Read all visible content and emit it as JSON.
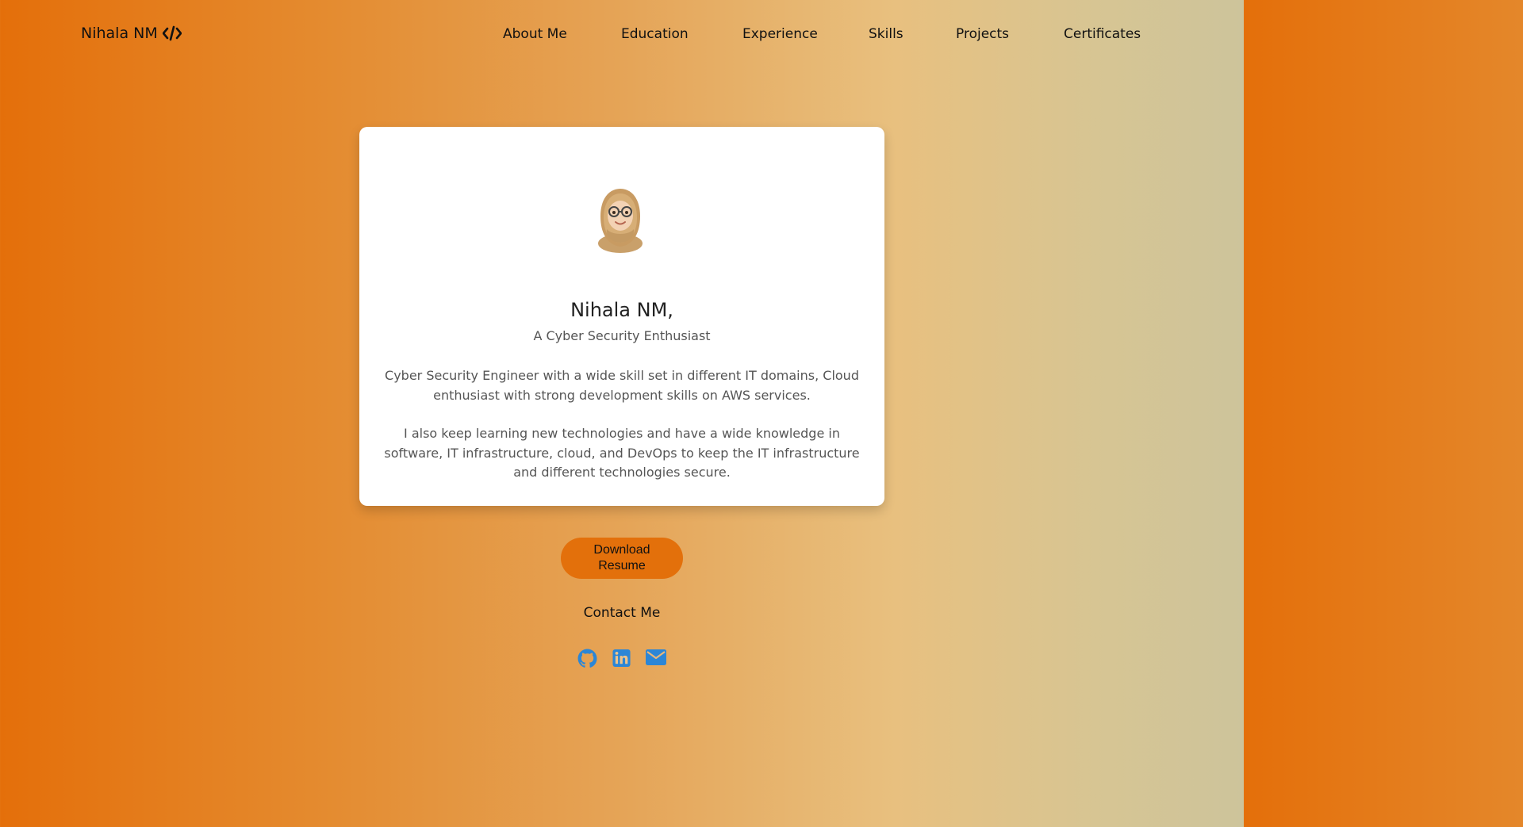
{
  "brand": {
    "name": "Nihala NM",
    "icon": "code-icon"
  },
  "nav": {
    "items": [
      {
        "label": "About Me"
      },
      {
        "label": "Education"
      },
      {
        "label": "Experience"
      },
      {
        "label": "Skills"
      },
      {
        "label": "Projects"
      },
      {
        "label": "Certificates"
      }
    ]
  },
  "profile": {
    "avatar_icon": "memoji-avatar",
    "name": "Nihala NM,",
    "subtitle": "A Cyber Security Enthusiast",
    "paragraphs": [
      "Cyber Security Engineer with a wide skill set in different IT domains, Cloud enthusiast with strong development skills on AWS services.",
      "I also keep learning new technologies and have a wide knowledge in software, IT infrastructure, cloud, and DevOps to keep the IT infrastructure and different technologies secure."
    ]
  },
  "actions": {
    "download_label": "Download Resume",
    "contact_label": "Contact Me"
  },
  "social": [
    {
      "icon": "github-icon"
    },
    {
      "icon": "linkedin-icon"
    },
    {
      "icon": "mail-icon"
    }
  ],
  "colors": {
    "accent": "#e3700b",
    "icon_blue": "#2c86d6",
    "gradient_start": "#e46f0a",
    "gradient_end": "#cdc49b"
  }
}
